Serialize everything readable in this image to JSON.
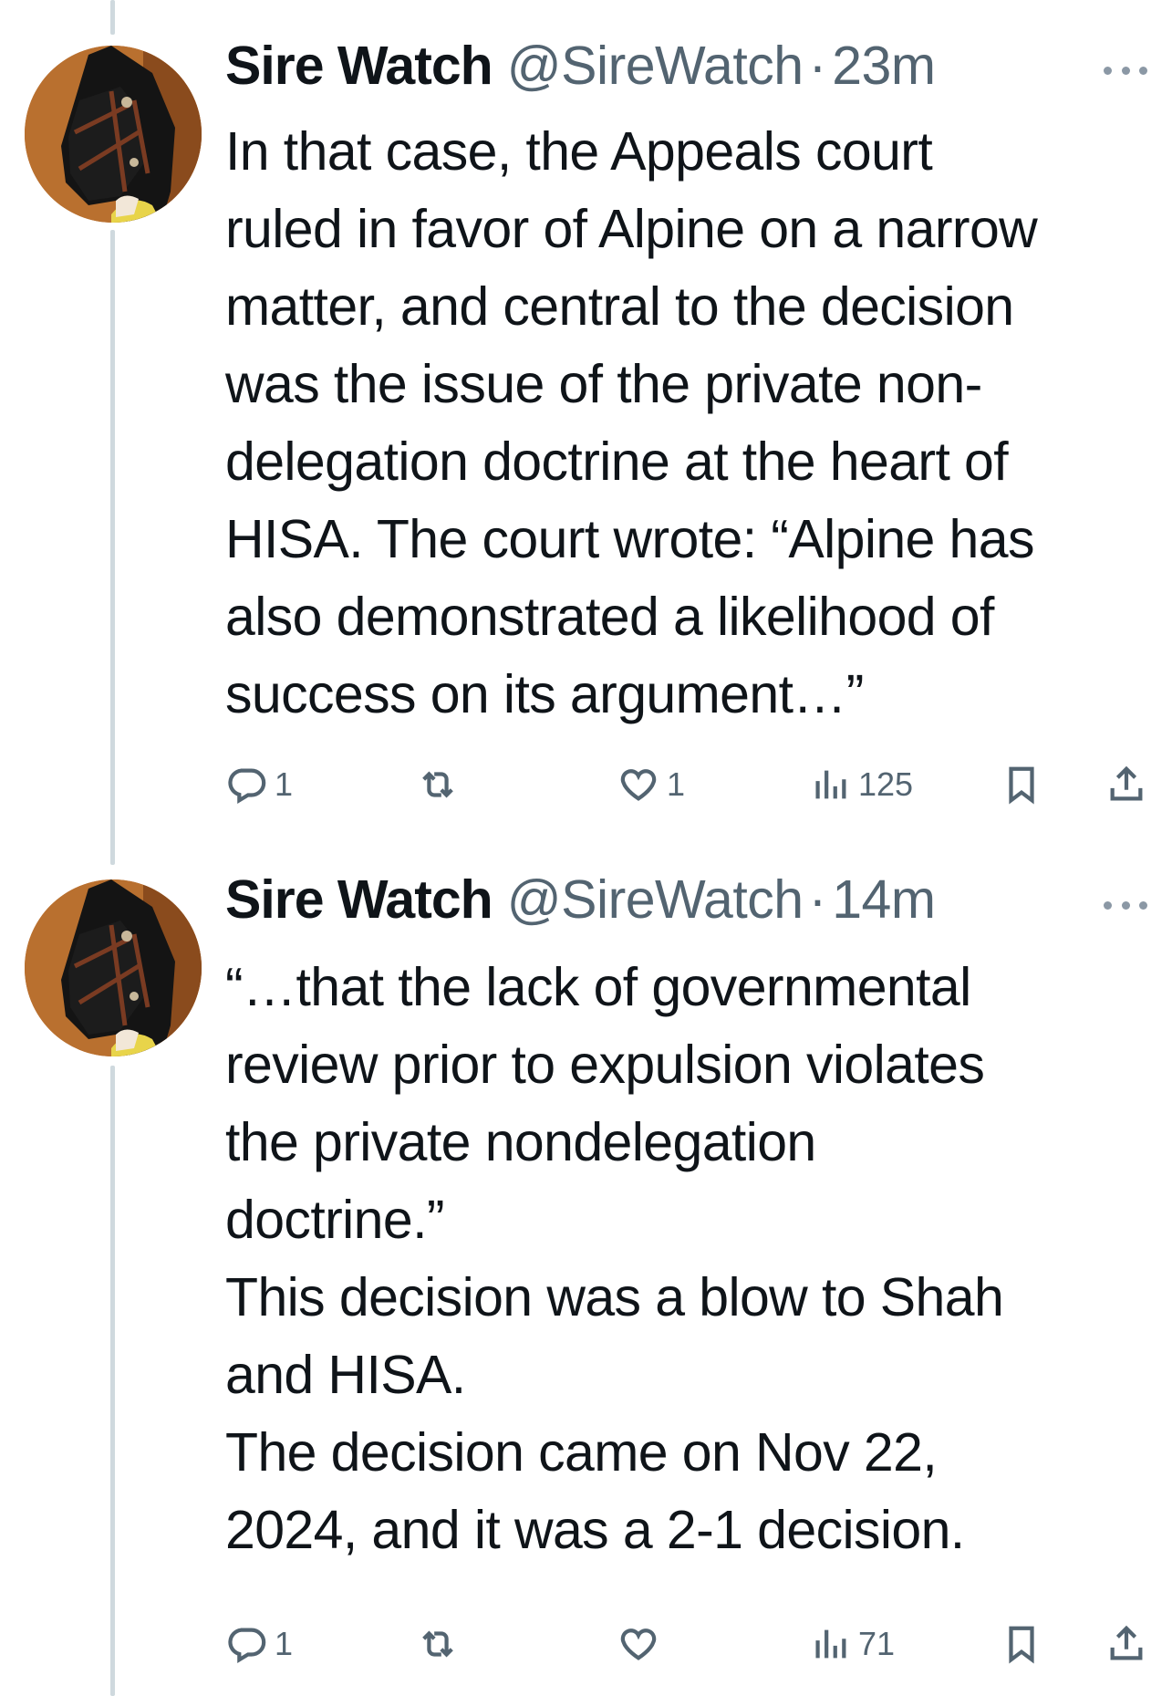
{
  "tweets": [
    {
      "name": "Sire Watch",
      "handle": "@SireWatch",
      "separator": "·",
      "time": "23m",
      "text": "In that case, the Appeals court\nruled in favor of Alpine on a narrow\nmatter, and central to the decision\nwas the issue of the private non-\ndelegation doctrine at the heart of\nHISA. The court wrote: “Alpine has\nalso demonstrated a likelihood of\nsuccess on its argument…”",
      "replies": "1",
      "retweets": "",
      "likes": "1",
      "views": "125",
      "icons": [
        "reply-icon",
        "retweet-icon",
        "like-icon",
        "views-icon",
        "bookmark-icon",
        "share-icon"
      ]
    },
    {
      "name": "Sire Watch",
      "handle": "@SireWatch",
      "separator": "·",
      "time": "14m",
      "text": "“…that the lack of governmental\nreview prior to expulsion violates\nthe private nondelegation\ndoctrine.”\nThis decision was a blow to Shah\nand HISA.\nThe decision came on Nov 22,\n2024, and it was a 2-1 decision.",
      "replies": "1",
      "retweets": "",
      "likes": "",
      "views": "71",
      "icons": [
        "reply-icon",
        "retweet-icon",
        "like-icon",
        "views-icon",
        "bookmark-icon",
        "share-icon"
      ]
    }
  ],
  "colors": {
    "text": "#0f1419",
    "secondary": "#536471",
    "thread_line": "#cfd9de"
  }
}
